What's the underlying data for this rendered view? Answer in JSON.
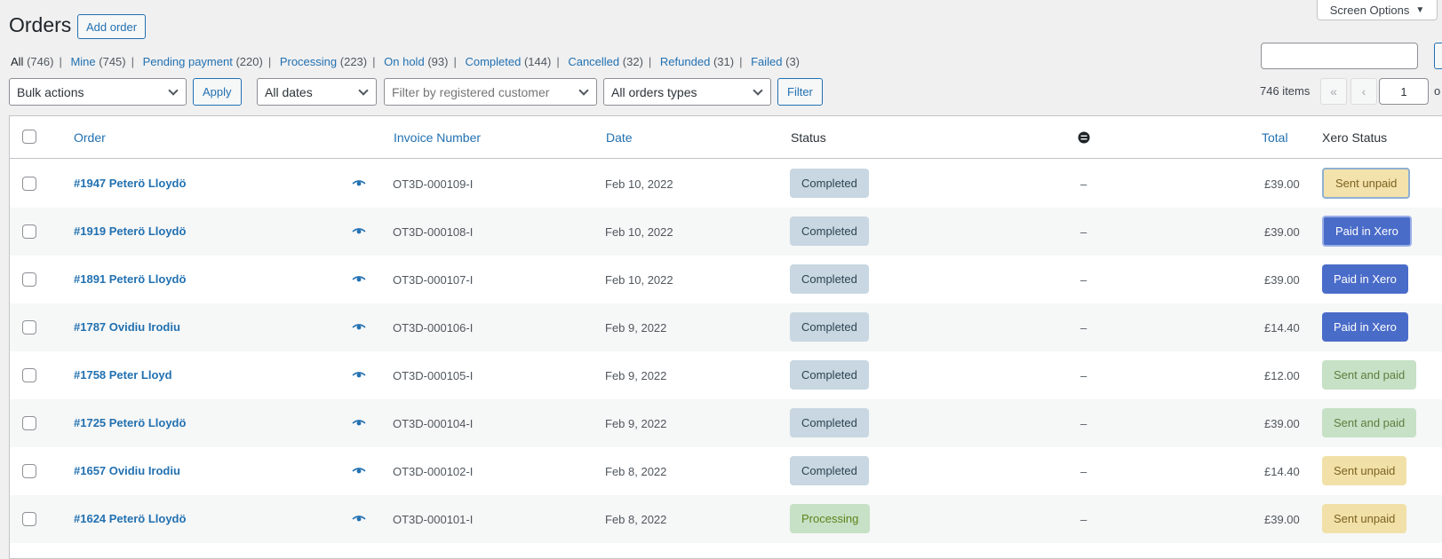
{
  "header": {
    "screen_options": "Screen Options",
    "title": "Orders",
    "add_order": "Add order"
  },
  "filters_views": [
    {
      "label": "All",
      "count": "(746)",
      "current": true
    },
    {
      "label": "Mine",
      "count": "(745)"
    },
    {
      "label": "Pending payment",
      "count": "(220)"
    },
    {
      "label": "Processing",
      "count": "(223)"
    },
    {
      "label": "On hold",
      "count": "(93)"
    },
    {
      "label": "Completed",
      "count": "(144)"
    },
    {
      "label": "Cancelled",
      "count": "(32)"
    },
    {
      "label": "Refunded",
      "count": "(31)"
    },
    {
      "label": "Failed",
      "count": "(3)"
    }
  ],
  "toolbar": {
    "bulk_actions": "Bulk actions",
    "apply": "Apply",
    "dates": "All dates",
    "customer_placeholder": "Filter by registered customer",
    "order_types": "All orders types",
    "filter": "Filter"
  },
  "pagination": {
    "items": "746 items",
    "first": "«",
    "prev": "‹",
    "page": "1",
    "of": "o"
  },
  "columns": {
    "order": "Order",
    "invoice": "Invoice Number",
    "date": "Date",
    "status": "Status",
    "total": "Total",
    "xero_status": "Xero Status"
  },
  "rows": [
    {
      "order": "#1947 Peterö Lloydö",
      "invoice": "OT3D-000109-I",
      "date": "Feb 10, 2022",
      "status": "Completed",
      "dash": "–",
      "total": "£39.00",
      "xero": "Sent unpaid"
    },
    {
      "order": "#1919 Peterö Lloydö",
      "invoice": "OT3D-000108-I",
      "date": "Feb 10, 2022",
      "status": "Completed",
      "dash": "–",
      "total": "£39.00",
      "xero": "Paid in Xero"
    },
    {
      "order": "#1891 Peterö Lloydö",
      "invoice": "OT3D-000107-I",
      "date": "Feb 10, 2022",
      "status": "Completed",
      "dash": "–",
      "total": "£39.00",
      "xero": "Paid in Xero"
    },
    {
      "order": "#1787 Ovidiu Irodiu",
      "invoice": "OT3D-000106-I",
      "date": "Feb 9, 2022",
      "status": "Completed",
      "dash": "–",
      "total": "£14.40",
      "xero": "Paid in Xero"
    },
    {
      "order": "#1758 Peter Lloyd",
      "invoice": "OT3D-000105-I",
      "date": "Feb 9, 2022",
      "status": "Completed",
      "dash": "–",
      "total": "£12.00",
      "xero": "Sent and paid"
    },
    {
      "order": "#1725 Peterö Lloydö",
      "invoice": "OT3D-000104-I",
      "date": "Feb 9, 2022",
      "status": "Completed",
      "dash": "–",
      "total": "£39.00",
      "xero": "Sent and paid"
    },
    {
      "order": "#1657 Ovidiu Irodiu",
      "invoice": "OT3D-000102-I",
      "date": "Feb 8, 2022",
      "status": "Completed",
      "dash": "–",
      "total": "£14.40",
      "xero": "Sent unpaid"
    },
    {
      "order": "#1624 Peterö Lloydö",
      "invoice": "OT3D-000101-I",
      "date": "Feb 8, 2022",
      "status": "Processing",
      "dash": "–",
      "total": "£39.00",
      "xero": "Sent unpaid"
    }
  ],
  "colors": {
    "link": "#2271b1",
    "completed_bg": "#c8d7e1",
    "processing_bg": "#c6e1c6",
    "xero_paid_bg": "#4a6cc9",
    "xero_unpaid_bg": "#f1e1a8"
  }
}
